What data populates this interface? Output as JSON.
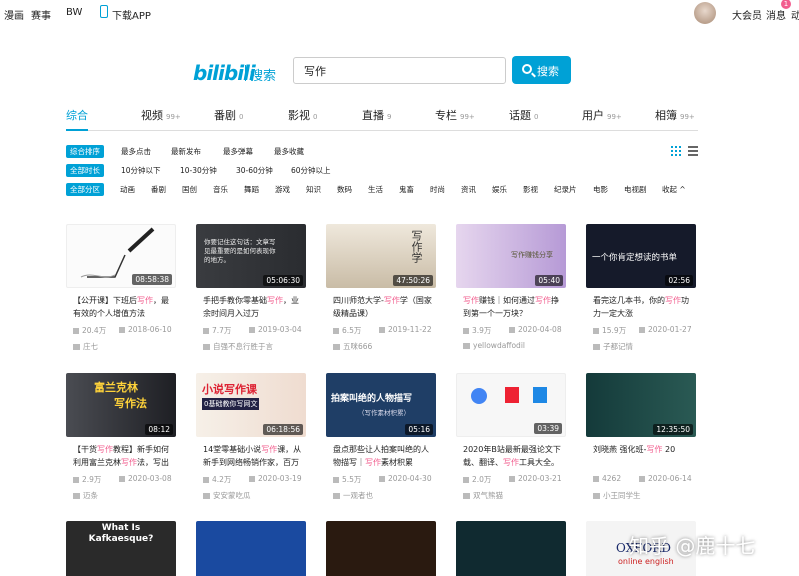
{
  "topnav": {
    "items": [
      "漫画",
      "赛事",
      "BW"
    ],
    "app": "下载APP"
  },
  "user": {
    "vip": "大会员",
    "msg": "消息",
    "msg_badge": "1",
    "more": "动"
  },
  "brand": {
    "sub": "搜索"
  },
  "search": {
    "value": "写作",
    "button": "搜索"
  },
  "tabs": [
    {
      "label": "综合",
      "count": ""
    },
    {
      "label": "视频",
      "count": "99+"
    },
    {
      "label": "番剧",
      "count": "0"
    },
    {
      "label": "影视",
      "count": "0"
    },
    {
      "label": "直播",
      "count": "9"
    },
    {
      "label": "专栏",
      "count": "99+"
    },
    {
      "label": "话题",
      "count": "0"
    },
    {
      "label": "用户",
      "count": "99+"
    },
    {
      "label": "相簿",
      "count": "99+"
    }
  ],
  "filters": {
    "order": {
      "active": "综合排序",
      "options": [
        "最多点击",
        "最新发布",
        "最多弹幕",
        "最多收藏"
      ]
    },
    "duration": {
      "active": "全部时长",
      "options": [
        "10分钟以下",
        "10-30分钟",
        "30-60分钟",
        "60分钟以上"
      ]
    },
    "zone": {
      "active": "全部分区",
      "options": [
        "动画",
        "番剧",
        "国创",
        "音乐",
        "舞蹈",
        "游戏",
        "知识",
        "数码",
        "生活",
        "鬼畜",
        "时尚",
        "资讯",
        "娱乐",
        "影视",
        "纪录片",
        "电影",
        "电视剧",
        "收起"
      ]
    }
  },
  "videos": [
    {
      "title": "【公开课】下班后写作，最有效的个人增值方法",
      "duration": "08:58:38",
      "plays": "20.4万",
      "date": "2018-06-10",
      "uploader": "庄七"
    },
    {
      "title": "手把手教你零基础写作，业余时间月入过万",
      "duration": "05:06:30",
      "plays": "7.7万",
      "date": "2019-03-04",
      "uploader": "自强不息行胜于言"
    },
    {
      "title": "四川师范大学-写作学（国家级精品课）",
      "duration": "47:50:26",
      "plays": "6.5万",
      "date": "2019-11-22",
      "uploader": "五咪666"
    },
    {
      "title": "写作赚钱｜如何通过写作挣到第一个一万块？",
      "duration": "05:40",
      "plays": "3.9万",
      "date": "2020-04-08",
      "uploader": "yellowdaffodil"
    },
    {
      "title": "看完这几本书，你的写作功力一定大涨",
      "duration": "02:56",
      "plays": "15.9万",
      "date": "2020-01-27",
      "uploader": "子都记情"
    },
    {
      "title": "【干货写作教程】新手如何利用富兰克林写作法，写出",
      "duration": "08:12",
      "plays": "2.9万",
      "date": "2020-03-08",
      "uploader": "迈条"
    },
    {
      "title": "14堂零基础小说写作课，从新手到网络畅销作家，百万",
      "duration": "06:18:56",
      "plays": "4.2万",
      "date": "2020-03-19",
      "uploader": "安安蒙吃瓜"
    },
    {
      "title": "盘点那些让人拍案叫绝的人物描写｜写作素材积累",
      "duration": "05:16",
      "plays": "5.5万",
      "date": "2020-04-30",
      "uploader": "一观者也"
    },
    {
      "title": "2020年B站最新最强论文下载、翻译、写作工具大全。",
      "duration": "03:39",
      "plays": "2.0万",
      "date": "2020-03-21",
      "uploader": "双气熊猫"
    },
    {
      "title": "刘晓燕 强化班-写作 20",
      "duration": "12:35:50",
      "plays": "4262",
      "date": "2020-06-14",
      "uploader": "小王同学生"
    }
  ],
  "thumb_text": {
    "t2": "你要记住这句话：文章写见最重要的是如何表现你的地方。",
    "t3": "写作学",
    "t4": "写作赚钱分享",
    "t5": "一个你肯定想读的书单",
    "t6a": "富兰克林",
    "t6b": "写作法",
    "t7a": "小说写作课",
    "t7b": "0基础教你写网文",
    "t8a": "拍案叫绝的人物描写",
    "t8b": "（写作素材积累）",
    "t11": "What Is Kafkaesque?",
    "t15a": "OXFORD",
    "t15b": "online english"
  },
  "watermark": "知乎 @鹿十七",
  "colors": {
    "accent": "#00a1d6",
    "highlight": "#f25d8e"
  }
}
